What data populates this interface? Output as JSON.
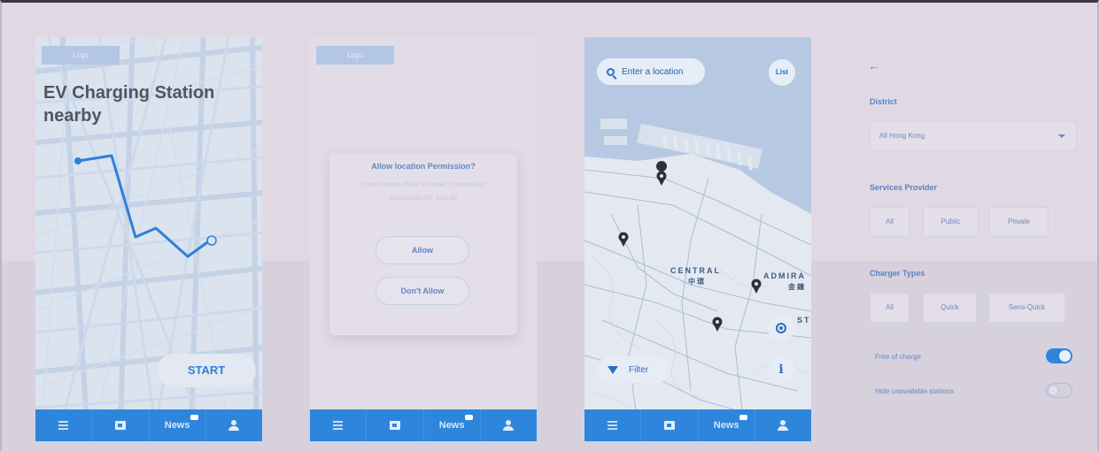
{
  "screens": {
    "splash": {
      "logo": "Logo",
      "headline": "EV Charging Station nearby",
      "start_label": "START"
    },
    "permission": {
      "logo": "Logo",
      "dialog_title": "Allow location Permission?",
      "dialog_body": "Lorem ipsum dolor sit amet, consectetur adipiscing elit, sed do",
      "allow_label": "Allow",
      "deny_label": "Don't Allow"
    },
    "map": {
      "search_placeholder": "Enter a location",
      "list_label": "List",
      "filter_label": "Filter",
      "labels": {
        "central": "CENTRAL",
        "central_zh": "中環",
        "admiralty": "ADMIRA",
        "admiralty_zh": "金鐘",
        "st": "ST"
      }
    }
  },
  "nav": {
    "news_label": "News",
    "icons": [
      "menu-icon",
      "station-icon",
      "news-icon",
      "user-icon"
    ]
  },
  "filter_panel": {
    "district": {
      "label": "District",
      "selected": "All Hong Kong"
    },
    "services_provider": {
      "label": "Services Provider",
      "options": [
        "All",
        "Public",
        "Private"
      ]
    },
    "charger_types": {
      "label": "Charger Types",
      "options": [
        "All",
        "Quick",
        "Semi-Quick"
      ]
    },
    "toggles": [
      {
        "label": "Free of charge",
        "on": true
      },
      {
        "label": "Hide unavailable stations",
        "on": false
      }
    ]
  },
  "colors": {
    "accent": "#2e86dc",
    "background": "#e0d9e3",
    "map_water": "#b7c9e2"
  }
}
